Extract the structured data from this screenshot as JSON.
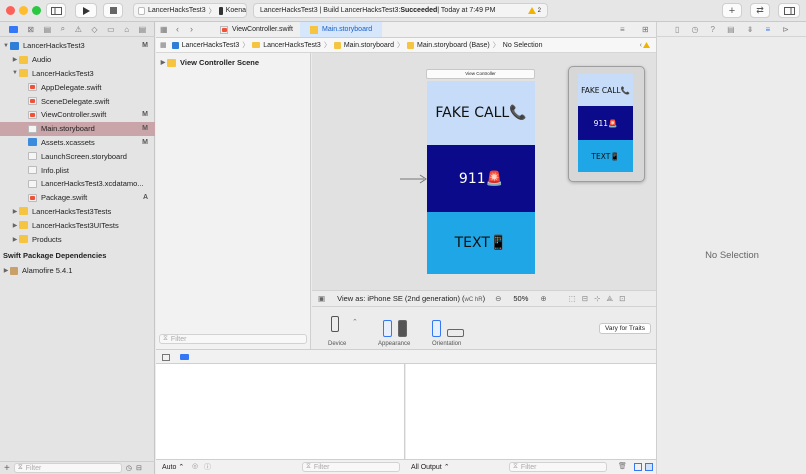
{
  "toolbar": {
    "scheme_project": "LancerHacksTest3",
    "scheme_device": "Koena",
    "status_prefix": "LancerHacksTest3 | Build LancerHacksTest3: ",
    "status_result": "Succeeded",
    "status_time": " | Today at 7:49 PM",
    "warning_count": "2",
    "plus_label": "+",
    "swap_label": "⇄"
  },
  "navigator": {
    "items": [
      {
        "label": "LancerHacksTest3",
        "badge": "M",
        "icon": "project-icon",
        "indent": 0,
        "disclosure": "▼"
      },
      {
        "label": "Audio",
        "badge": "",
        "icon": "folder-icon",
        "indent": 1,
        "disclosure": "▶"
      },
      {
        "label": "LancerHacksTest3",
        "badge": "",
        "icon": "folder-icon",
        "indent": 1,
        "disclosure": "▼"
      },
      {
        "label": "AppDelegate.swift",
        "badge": "",
        "icon": "swift-file-icon",
        "indent": 2,
        "disclosure": ""
      },
      {
        "label": "SceneDelegate.swift",
        "badge": "",
        "icon": "swift-file-icon",
        "indent": 2,
        "disclosure": ""
      },
      {
        "label": "ViewController.swift",
        "badge": "M",
        "icon": "swift-file-icon",
        "indent": 2,
        "disclosure": ""
      },
      {
        "label": "Main.storyboard",
        "badge": "M",
        "icon": "storyboard-icon",
        "indent": 2,
        "disclosure": ""
      },
      {
        "label": "Assets.xcassets",
        "badge": "M",
        "icon": "assets-icon",
        "indent": 2,
        "disclosure": ""
      },
      {
        "label": "LaunchScreen.storyboard",
        "badge": "",
        "icon": "storyboard-icon",
        "indent": 2,
        "disclosure": ""
      },
      {
        "label": "Info.plist",
        "badge": "",
        "icon": "plist-icon",
        "indent": 2,
        "disclosure": ""
      },
      {
        "label": "LancerHacksTest3.xcdatamo...",
        "badge": "",
        "icon": "datamodel-icon",
        "indent": 2,
        "disclosure": ""
      },
      {
        "label": "Package.swift",
        "badge": "A",
        "icon": "swift-file-icon",
        "indent": 2,
        "disclosure": ""
      },
      {
        "label": "LancerHacksTest3Tests",
        "badge": "",
        "icon": "folder-icon",
        "indent": 1,
        "disclosure": "▶"
      },
      {
        "label": "LancerHacksTest3UITests",
        "badge": "",
        "icon": "folder-icon",
        "indent": 1,
        "disclosure": "▶"
      },
      {
        "label": "Products",
        "badge": "",
        "icon": "folder-icon",
        "indent": 1,
        "disclosure": "▶"
      }
    ],
    "selected_label": "Main.storyboard",
    "spm_header": "Swift Package Dependencies",
    "spm_item": "Alamofire 5.4.1",
    "filter_placeholder": "Filter"
  },
  "editor": {
    "tabs": [
      "ViewController.swift",
      "Main.storyboard"
    ],
    "active_tab": "Main.storyboard",
    "breadcrumb": [
      "LancerHacksTest3",
      "LancerHacksTest3",
      "Main.storyboard",
      "Main.storyboard (Base)",
      "No Selection"
    ],
    "scene_label": "View Controller Scene",
    "outline_filter_placeholder": "Filter"
  },
  "storyboard": {
    "vc_title": "View Controller",
    "buttons": [
      {
        "text": "FAKE CALL📞",
        "color": "#c7dcf8"
      },
      {
        "text": "911🚨",
        "color": "#0a0a8a"
      },
      {
        "text": "TEXT📱",
        "color": "#1ea6e6"
      }
    ]
  },
  "canvas_bar": {
    "view_as": "View as: iPhone SE (2nd generation) (",
    "size_class": "wC hR",
    "view_as_end": ")",
    "zoom": "50%"
  },
  "device_config": {
    "device_label": "Device",
    "appearance_label": "Appearance",
    "orientation_label": "Orientation",
    "vary_button": "Vary for Traits"
  },
  "debug": {
    "auto_label": "Auto",
    "filter_placeholder": "Filter",
    "output_label": "All Output",
    "output_filter_placeholder": "Filter"
  },
  "inspector": {
    "empty_label": "No Selection"
  },
  "colors": {
    "accent": "#3478f6",
    "selection": "#c9a5aa",
    "warning": "#f0b400"
  }
}
